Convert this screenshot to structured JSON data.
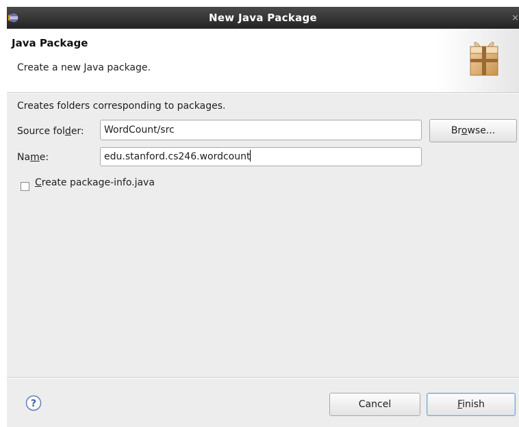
{
  "window": {
    "title": "New Java Package",
    "close_glyph": "×",
    "app_icon": "eclipse-icon"
  },
  "banner": {
    "title": "Java Package",
    "description": "Create a new Java package.",
    "icon": "package-icon"
  },
  "form": {
    "intro": "Creates folders corresponding to packages.",
    "source_folder": {
      "label_before": "Source fol",
      "label_mnemonic": "d",
      "label_after": "er:",
      "value": "WordCount/src"
    },
    "browse_button": {
      "before": "Br",
      "mnemonic": "o",
      "after": "wse..."
    },
    "name": {
      "label_before": "Na",
      "label_mnemonic": "m",
      "label_after": "e:",
      "value": "edu.stanford.cs246.wordcount"
    },
    "package_info_checkbox": {
      "mnemonic": "C",
      "label_rest": "reate package-info.java",
      "checked": false
    }
  },
  "footer": {
    "help_icon": "help-icon",
    "cancel_label": "Cancel",
    "finish_button": {
      "mnemonic": "F",
      "rest": "inish"
    }
  },
  "colors": {
    "titlebar": "#2e2e2e",
    "dialog_bg": "#ededed",
    "default_button_border": "#7a9fd6"
  }
}
